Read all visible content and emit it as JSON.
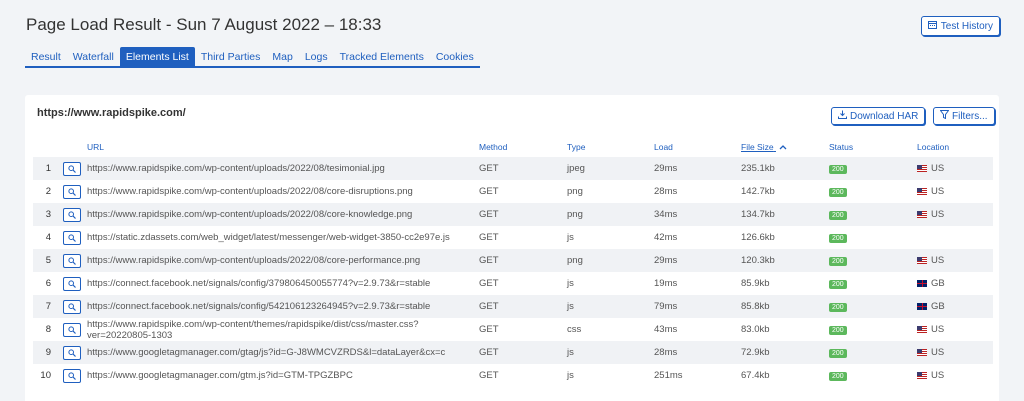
{
  "page": {
    "title": "Page Load Result - Sun 7 August 2022 – 18:33",
    "history_button": "Test History"
  },
  "tabs": [
    {
      "label": "Result",
      "active": false
    },
    {
      "label": "Waterfall",
      "active": false
    },
    {
      "label": "Elements List",
      "active": true
    },
    {
      "label": "Third Parties",
      "active": false
    },
    {
      "label": "Map",
      "active": false
    },
    {
      "label": "Logs",
      "active": false
    },
    {
      "label": "Tracked Elements",
      "active": false
    },
    {
      "label": "Cookies",
      "active": false
    }
  ],
  "card": {
    "site_url": "https://www.rapidspike.com/",
    "download_har": "Download HAR",
    "filters": "Filters..."
  },
  "table": {
    "headers": {
      "url": "URL",
      "method": "Method",
      "type": "Type",
      "load": "Load",
      "file_size": "File Size",
      "status": "Status",
      "location": "Location"
    },
    "rows": [
      {
        "n": "1",
        "url": "https://www.rapidspike.com/wp-content/uploads/2022/08/tesimonial.jpg",
        "method": "GET",
        "type": "jpeg",
        "load": "29ms",
        "size": "235.1kb",
        "status": "200",
        "country": "US",
        "flag": "us"
      },
      {
        "n": "2",
        "url": "https://www.rapidspike.com/wp-content/uploads/2022/08/core-disruptions.png",
        "method": "GET",
        "type": "png",
        "load": "28ms",
        "size": "142.7kb",
        "status": "200",
        "country": "US",
        "flag": "us"
      },
      {
        "n": "3",
        "url": "https://www.rapidspike.com/wp-content/uploads/2022/08/core-knowledge.png",
        "method": "GET",
        "type": "png",
        "load": "34ms",
        "size": "134.7kb",
        "status": "200",
        "country": "US",
        "flag": "us"
      },
      {
        "n": "4",
        "url": "https://static.zdassets.com/web_widget/latest/messenger/web-widget-3850-cc2e97e.js",
        "method": "GET",
        "type": "js",
        "load": "42ms",
        "size": "126.6kb",
        "status": "200",
        "country": "",
        "flag": ""
      },
      {
        "n": "5",
        "url": "https://www.rapidspike.com/wp-content/uploads/2022/08/core-performance.png",
        "method": "GET",
        "type": "png",
        "load": "29ms",
        "size": "120.3kb",
        "status": "200",
        "country": "US",
        "flag": "us"
      },
      {
        "n": "6",
        "url": "https://connect.facebook.net/signals/config/379806450055774?v=2.9.73&r=stable",
        "method": "GET",
        "type": "js",
        "load": "19ms",
        "size": "85.9kb",
        "status": "200",
        "country": "GB",
        "flag": "gb"
      },
      {
        "n": "7",
        "url": "https://connect.facebook.net/signals/config/542106123264945?v=2.9.73&r=stable",
        "method": "GET",
        "type": "js",
        "load": "79ms",
        "size": "85.8kb",
        "status": "200",
        "country": "GB",
        "flag": "gb"
      },
      {
        "n": "8",
        "url": "https://www.rapidspike.com/wp-content/themes/rapidspike/dist/css/master.css?ver=20220805-1303",
        "method": "GET",
        "type": "css",
        "load": "43ms",
        "size": "83.0kb",
        "status": "200",
        "country": "US",
        "flag": "us"
      },
      {
        "n": "9",
        "url": "https://www.googletagmanager.com/gtag/js?id=G-J8WMCVZRDS&l=dataLayer&cx=c",
        "method": "GET",
        "type": "js",
        "load": "28ms",
        "size": "72.9kb",
        "status": "200",
        "country": "US",
        "flag": "us"
      },
      {
        "n": "10",
        "url": "https://www.googletagmanager.com/gtm.js?id=GTM-TPGZBPC",
        "method": "GET",
        "type": "js",
        "load": "251ms",
        "size": "67.4kb",
        "status": "200",
        "country": "US",
        "flag": "us"
      }
    ]
  }
}
